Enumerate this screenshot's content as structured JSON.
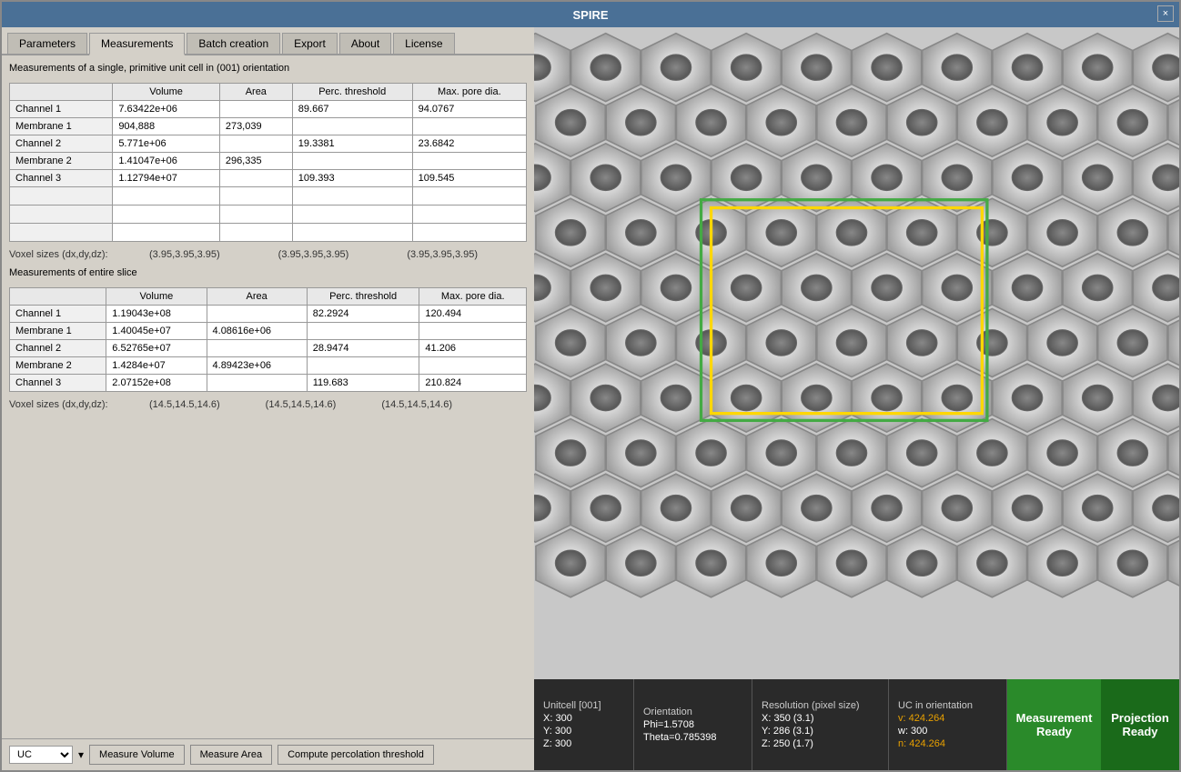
{
  "window": {
    "title": "SPIRE",
    "close_label": "×"
  },
  "tabs": [
    {
      "label": "Parameters",
      "active": false
    },
    {
      "label": "Measurements",
      "active": true
    },
    {
      "label": "Batch creation",
      "active": false
    },
    {
      "label": "Export",
      "active": false
    },
    {
      "label": "About",
      "active": false
    },
    {
      "label": "License",
      "active": false
    }
  ],
  "section1": {
    "title": "Measurements of a single, primitive unit cell in (001) orientation",
    "columns": [
      "",
      "Volume",
      "Area",
      "Perc. threshold",
      "Max. pore dia."
    ],
    "rows": [
      {
        "name": "Channel 1",
        "volume": "7.63422e+06",
        "area": "",
        "perc": "89.667",
        "maxpore": "94.0767"
      },
      {
        "name": "Membrane 1",
        "volume": "904,888",
        "area": "273,039",
        "perc": "",
        "maxpore": ""
      },
      {
        "name": "Channel 2",
        "volume": "5.771e+06",
        "area": "",
        "perc": "19.3381",
        "maxpore": "23.6842"
      },
      {
        "name": "Membrane 2",
        "volume": "1.41047e+06",
        "area": "296,335",
        "perc": "",
        "maxpore": ""
      },
      {
        "name": "Channel 3",
        "volume": "1.12794e+07",
        "area": "",
        "perc": "109.393",
        "maxpore": "109.545"
      }
    ]
  },
  "voxel1": {
    "label": "Voxel sizes (dx,dy,dz):",
    "v1": "(3.95,3.95,3.95)",
    "v2": "(3.95,3.95,3.95)",
    "v3": "(3.95,3.95,3.95)"
  },
  "section2": {
    "title": "Measurements of entire slice",
    "columns": [
      "",
      "Volume",
      "Area",
      "Perc. threshold",
      "Max. pore dia."
    ],
    "rows": [
      {
        "name": "Channel 1",
        "volume": "1.19043e+08",
        "area": "",
        "perc": "82.2924",
        "maxpore": "120.494"
      },
      {
        "name": "Membrane 1",
        "volume": "1.40045e+07",
        "area": "4.08616e+06",
        "perc": "",
        "maxpore": ""
      },
      {
        "name": "Channel 2",
        "volume": "6.52765e+07",
        "area": "",
        "perc": "28.9474",
        "maxpore": "41.206"
      },
      {
        "name": "Membrane 2",
        "volume": "1.4284e+07",
        "area": "4.89423e+06",
        "perc": "",
        "maxpore": ""
      },
      {
        "name": "Channel 3",
        "volume": "2.07152e+08",
        "area": "",
        "perc": "119.683",
        "maxpore": "210.824"
      }
    ]
  },
  "voxel2": {
    "label": "Voxel sizes (dx,dy,dz):",
    "v1": "(14.5,14.5,14.6)",
    "v2": "(14.5,14.5,14.6)",
    "v3": "(14.5,14.5,14.6)"
  },
  "bottom_bar": {
    "uc_label": "UC",
    "btn1": "Measure Volume",
    "btn2": "Measure Area",
    "btn3": "Compute percolation threshold"
  },
  "status": {
    "unitcell_label": "Unitcell [001]",
    "x_label": "X:",
    "x_val": "300",
    "y_label": "Y:",
    "y_val": "300",
    "z_label": "Z:",
    "z_val": "300",
    "orientation_label": "Orientation",
    "phi_label": "Phi=",
    "phi_val": "1.5708",
    "theta_label": "Theta=",
    "theta_val": "0.785398",
    "resolution_label": "Resolution (pixel size)",
    "rx_label": "X:",
    "rx_val": "350 (3.1)",
    "ry_label": "Y:",
    "ry_val": "286 (3.1)",
    "rz_label": "Z:",
    "rz_val": "250 (1.7)",
    "uc_orient_label": "UC in orientation",
    "uc_v": "v: 424.264",
    "uc_w": "w: 300",
    "uc_n": "n: 424.264",
    "ready_label": "Measurement",
    "ready_sub": "Ready",
    "proj_label": "Projection",
    "proj_sub": "Ready"
  }
}
